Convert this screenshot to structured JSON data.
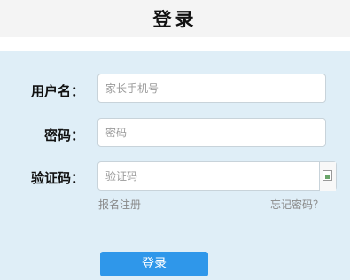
{
  "header": {
    "title": "登录"
  },
  "form": {
    "username": {
      "label": "用户名：",
      "placeholder": "家长手机号",
      "value": ""
    },
    "password": {
      "label": "密码：",
      "placeholder": "密码",
      "value": ""
    },
    "captcha": {
      "label": "验证码：",
      "placeholder": "验证码",
      "value": ""
    },
    "register_link": "报名注册",
    "forgot_link": "忘记密码？",
    "submit_label": "登录"
  },
  "colors": {
    "header_bg": "#f4f4f4",
    "form_bg": "#dfeef7",
    "button": "#2f97ea"
  }
}
